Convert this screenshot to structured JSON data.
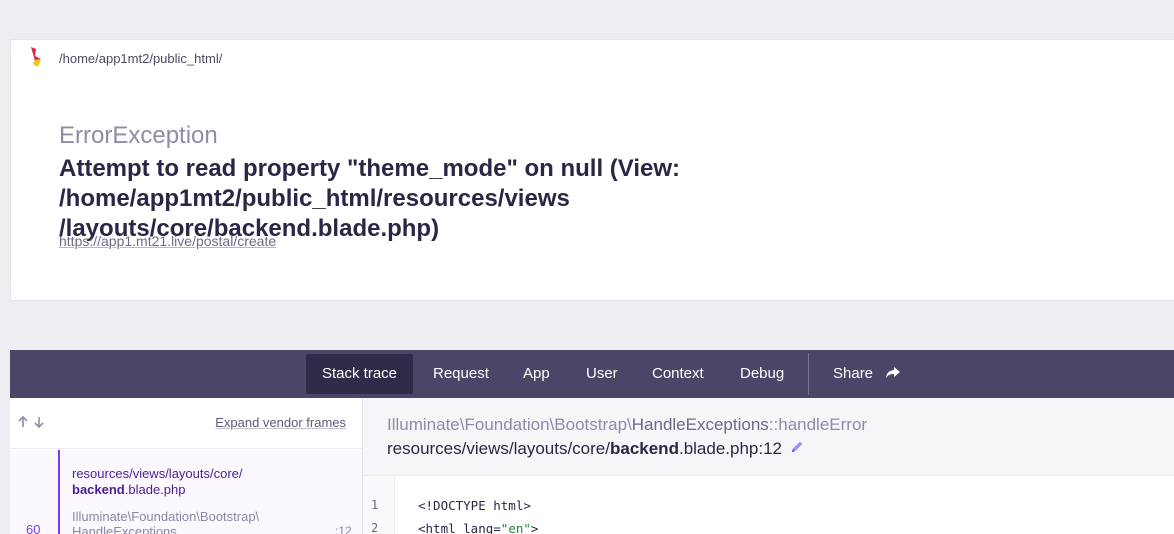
{
  "topbar": {
    "path": "/home/app1mt2/public_html/"
  },
  "error": {
    "exception_class": "ErrorException",
    "message_line1": "Attempt to read property \"theme_mode\" on null (View: /home/app1mt2/public_html/resources/views",
    "message_line2": "/layouts/core/backend.blade.php)",
    "url": "https://app1.mt21.live/postal/create"
  },
  "tabs": [
    {
      "label": "Stack trace",
      "active": true
    },
    {
      "label": "Request"
    },
    {
      "label": "App"
    },
    {
      "label": "User"
    },
    {
      "label": "Context"
    },
    {
      "label": "Debug"
    },
    {
      "label": "Share"
    }
  ],
  "sidebar": {
    "expand_label": "Expand vendor frames",
    "frame": {
      "file_path": "resources/views/layouts/core/",
      "file_name": "backend",
      "file_ext": ".blade.php",
      "class_line1": "Illuminate\\Foundation\\Bootstrap\\",
      "class_line2": "HandleExceptions",
      "number": "60",
      "line": ":12"
    }
  },
  "detail": {
    "class_prefix": "Illuminate\\Foundation\\Bootstrap\\",
    "class_name": "HandleExceptions",
    "method": "::handleError",
    "file_prefix": "resources/views/layouts/core/",
    "file_bold": "backend",
    "file_suffix": ".blade.php:12"
  },
  "code": {
    "lines": [
      {
        "num": "1",
        "text": "<!DOCTYPE html>"
      },
      {
        "num": "2",
        "pre": "<html lang=",
        "str": "\"en\"",
        "post": ">"
      }
    ]
  },
  "colors": {
    "nav_bg": "#4a4668",
    "nav_active": "#2f2c4a",
    "accent": "#7c3aed"
  }
}
